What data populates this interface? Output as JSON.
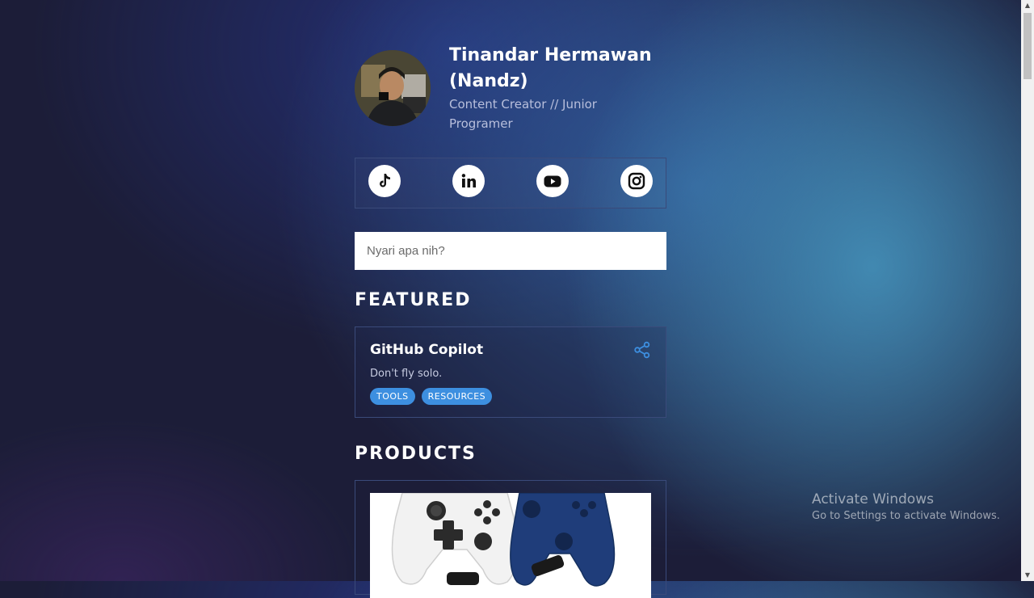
{
  "profile": {
    "name": "Tinandar Hermawan (Nandz)",
    "bio": "Content Creator // Junior Programer"
  },
  "socials": [
    {
      "icon": "tiktok-icon"
    },
    {
      "icon": "linkedin-icon"
    },
    {
      "icon": "youtube-icon"
    },
    {
      "icon": "instagram-icon"
    }
  ],
  "search": {
    "placeholder": "Nyari apa nih?"
  },
  "featured": {
    "heading": "FEATURED",
    "card": {
      "title": "GitHub Copilot",
      "description": "Don't fly solo.",
      "tags": [
        "TOOLS",
        "RESOURCES"
      ]
    }
  },
  "products": {
    "heading": "PRODUCTS"
  },
  "watermark": {
    "title": "Activate Windows",
    "subtitle": "Go to Settings to activate Windows."
  },
  "colors": {
    "accent": "#3d8fe0",
    "background": "#1c1d38"
  }
}
